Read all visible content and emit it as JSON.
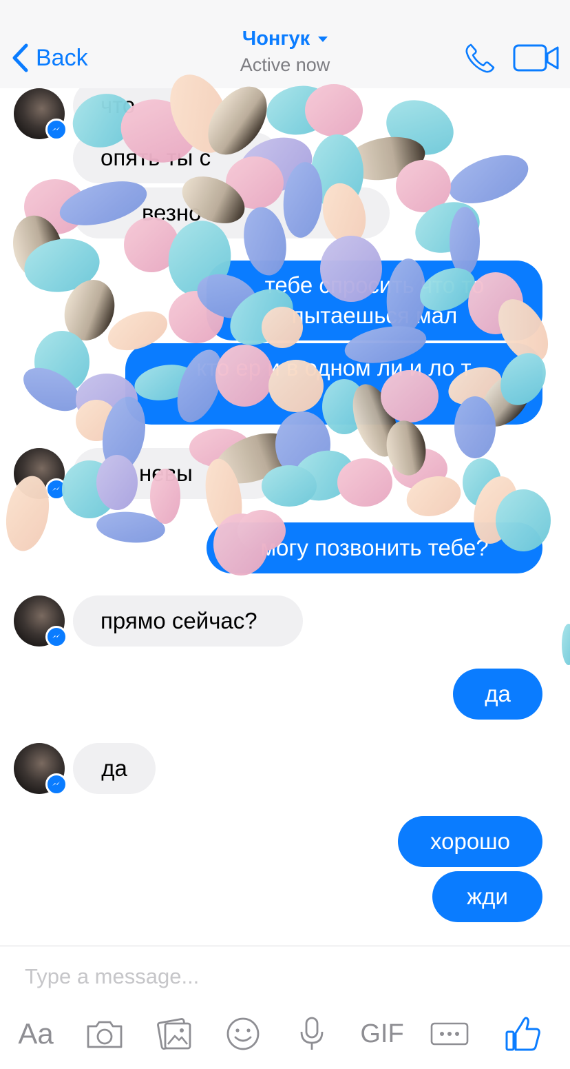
{
  "header": {
    "back_label": "Back",
    "contact_name": "Чонгук",
    "status": "Active now"
  },
  "messages": [
    {
      "dir": "in",
      "text": "что"
    },
    {
      "dir": "in",
      "text": "опять ты с"
    },
    {
      "dir": "in",
      "text": "везно"
    },
    {
      "dir": "out",
      "text": "тебе спросить что то пытаешься мал"
    },
    {
      "dir": "out",
      "text": "кто ер и в одном ли и ло т"
    },
    {
      "dir": "in",
      "text": "невы"
    },
    {
      "dir": "out",
      "text": "могу позвонить тебе?"
    },
    {
      "dir": "in",
      "text": "прямо сейчас?"
    },
    {
      "dir": "out",
      "text": "да"
    },
    {
      "dir": "in",
      "text": "да"
    },
    {
      "dir": "out",
      "text": "хорошо"
    },
    {
      "dir": "out",
      "text": "жди"
    }
  ],
  "composer": {
    "placeholder": "Type a message...",
    "aa_label": "Aa",
    "gif_label": "GIF"
  },
  "icons": [
    "chevron-left-icon",
    "phone-icon",
    "video-camera-icon",
    "messenger-icon",
    "camera-icon",
    "photo-gallery-icon",
    "emoji-icon",
    "microphone-icon",
    "more-icon",
    "thumbs-up-icon"
  ],
  "colors": {
    "accent": "#0a7cff",
    "incoming_bubble": "#f0f0f2",
    "muted": "#8e8e93"
  }
}
